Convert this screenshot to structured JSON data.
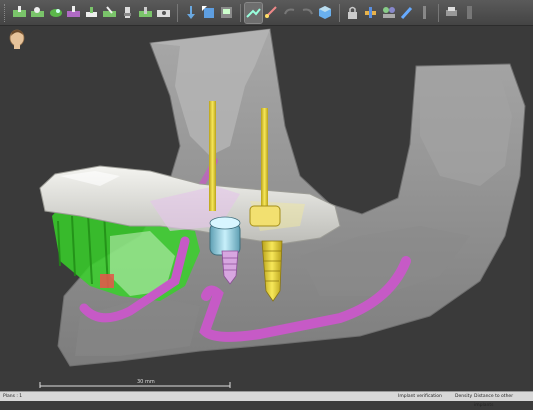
{
  "toolbar": {
    "buttons": [
      {
        "icon": "implant-plan-icon",
        "active": false
      },
      {
        "icon": "implant-layers-icon",
        "active": false
      },
      {
        "icon": "implant-green-icon",
        "active": false
      },
      {
        "icon": "implant-purple-icon",
        "active": false
      },
      {
        "icon": "implant-abutment-icon",
        "active": false
      },
      {
        "icon": "implant-tilt-icon",
        "active": false
      },
      {
        "icon": "implant-sleeve-icon",
        "active": false
      },
      {
        "icon": "implant-drill-icon",
        "active": false
      },
      {
        "icon": "implant-camera-icon",
        "active": false
      },
      {
        "icon": "anchor-pin-icon",
        "active": false
      },
      {
        "icon": "transform-icon",
        "active": false
      },
      {
        "icon": "save-view-icon",
        "active": false
      },
      {
        "icon": "view-align-icon",
        "active": true
      },
      {
        "icon": "measure-icon",
        "active": false
      },
      {
        "icon": "undo-icon",
        "active": false
      },
      {
        "icon": "redo-icon",
        "active": false
      },
      {
        "icon": "cube-view-icon",
        "active": false
      },
      {
        "icon": "lock-icon",
        "active": false
      },
      {
        "icon": "tools-icon",
        "active": false
      },
      {
        "icon": "people-icon",
        "active": false
      },
      {
        "icon": "brush-icon",
        "active": false
      },
      {
        "icon": "ruler-icon",
        "active": false
      },
      {
        "icon": "print-icon",
        "active": false
      },
      {
        "icon": "expand-icon",
        "active": false
      }
    ]
  },
  "viewport": {
    "scale_label": "30 mm"
  },
  "statusbar": {
    "planes": "Plans : 1",
    "implant_verification": "Implant verification",
    "density": "Density",
    "distance": "Distance to other implants"
  },
  "colors": {
    "background": "#3a3a3a",
    "bone": "#9b9b9b",
    "teeth_green": "#38d12a",
    "nerve_purple": "#c65ac6",
    "implant_yellow": "#e6d23a",
    "guide_white": "#e8e8e4",
    "sleeve_cyan": "#9fd8e8"
  }
}
